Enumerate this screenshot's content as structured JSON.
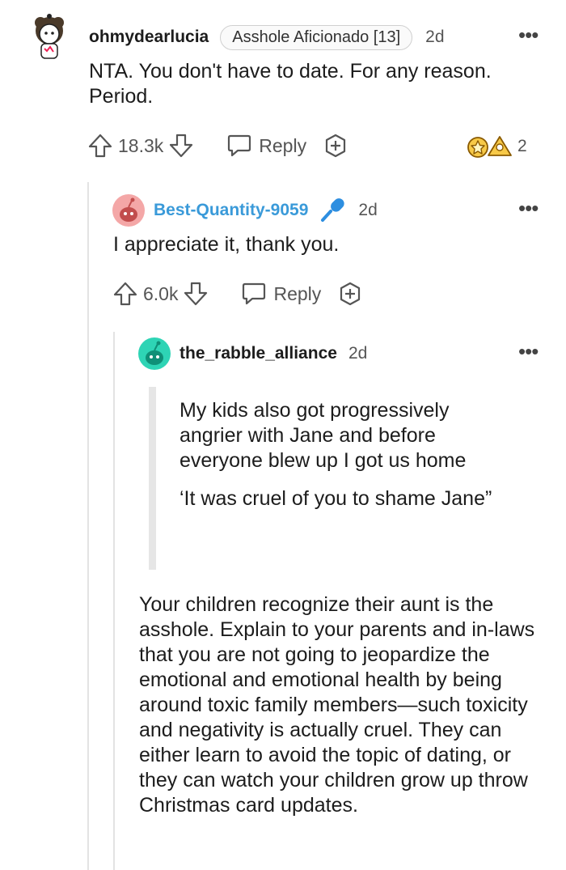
{
  "comments": [
    {
      "username": "ohmydearlucia",
      "flair": "Asshole Aficionado [13]",
      "time": "2d",
      "body": "NTA. You don't have to date. For any reason. Period.",
      "score": "18.3k",
      "reply_label": "Reply",
      "award_count": "2"
    },
    {
      "username": "Best-Quantity-9059",
      "time": "2d",
      "body": "I appreciate it, thank you.",
      "score": "6.0k",
      "reply_label": "Reply"
    },
    {
      "username": "the_rabble_alliance",
      "time": "2d",
      "quote": [
        "My kids also got progressively angrier with Jane and before everyone blew up I got us home",
        "‘It was cruel of you to shame Jane”"
      ],
      "body": "Your children recognize their aunt is the asshole. Explain to your parents and in-laws that you are not going to jeopardize the emotional and emotional health by being around toxic family members—such toxicity and negativity is actually cruel. They can either learn to avoid the topic of dating, or they can watch your children grow up throw Christmas card updates."
    }
  ],
  "more_label": "•••",
  "icons": {
    "upvote": "upvote-arrow-icon",
    "downvote": "downvote-arrow-icon",
    "reply": "reply-bubble-icon",
    "award": "add-award-icon",
    "mic": "microphone-icon"
  },
  "colors": {
    "username_op": "#3a9ad9",
    "avatar1": "#f4a7a7",
    "avatar2": "#2ed4b5"
  }
}
